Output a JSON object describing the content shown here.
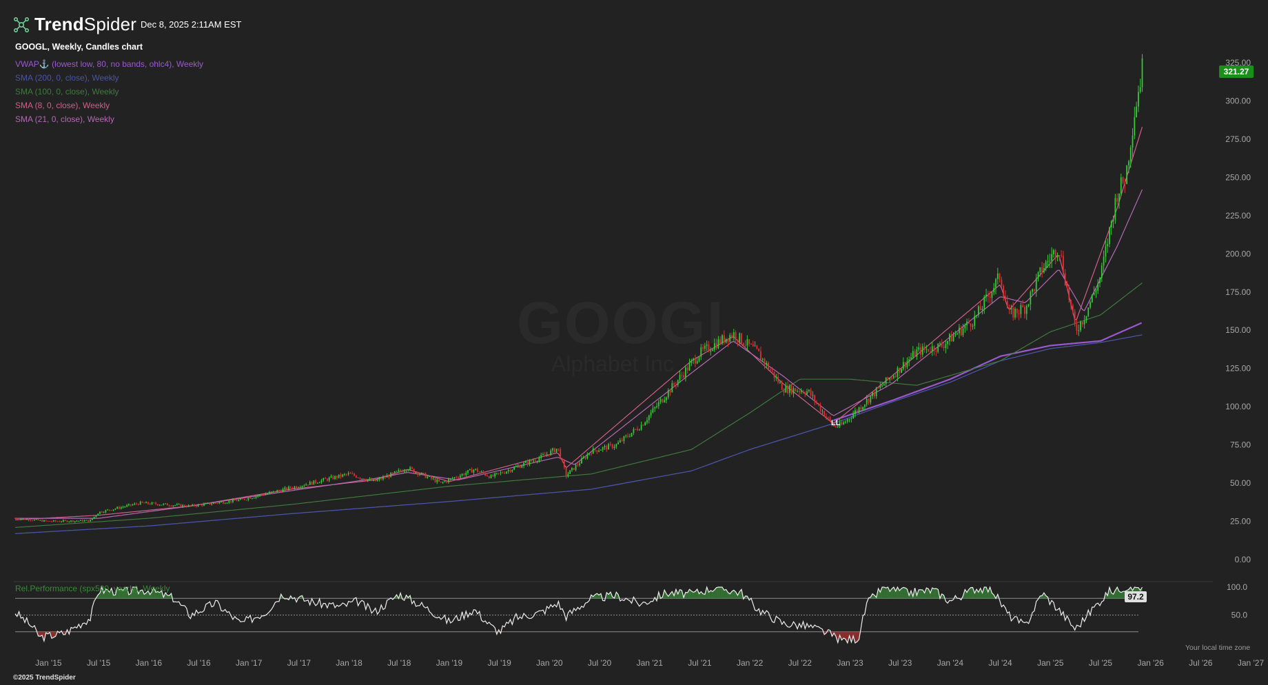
{
  "header": {
    "brand_bold": "Trend",
    "brand_rest": "Spider",
    "timestamp": "Dec 8, 2025 2:11AM EST",
    "chart_title": "GOOGL, Weekly, Candles chart"
  },
  "indicators": [
    {
      "label": "VWAP⚓ (lowest low, 80, no bands, ohlc4), Weekly",
      "color": "#9b59d0"
    },
    {
      "label": "SMA (200, 0, close), Weekly",
      "color": "#4b55a8"
    },
    {
      "label": "SMA (100, 0, close), Weekly",
      "color": "#3e7a3e"
    },
    {
      "label": "SMA (8, 0, close), Weekly",
      "color": "#d0608a"
    },
    {
      "label": "SMA (21, 0, close), Weekly",
      "color": "#b46ab4"
    }
  ],
  "watermark": {
    "symbol": "GOOGL",
    "company": "Alphabet Inc"
  },
  "price_badge": "321.27",
  "rel_perf": {
    "label": "Rel.Performance (spx500, yearly), Weekly",
    "value_badge": "97.2"
  },
  "local_time_note": "Your local time zone",
  "copyright": "©2025 TrendSpider",
  "anchor_marker": "LL",
  "colors": {
    "background": "#222222",
    "up": "#33cc33",
    "down": "#e03030",
    "badge_green": "#1a8f1a"
  },
  "chart_data": [
    {
      "type": "candlestick",
      "title": "GOOGL, Weekly, Candles chart",
      "ylim": [
        0,
        325
      ],
      "y_ticks": [
        "325.00",
        "300.00",
        "275.00",
        "250.00",
        "225.00",
        "200.00",
        "175.00",
        "150.00",
        "125.00",
        "100.00",
        "75.00",
        "50.00",
        "25.00",
        "0.00"
      ],
      "x_ticks": [
        "Jan '15",
        "Jul '15",
        "Jan '16",
        "Jul '16",
        "Jan '17",
        "Jul '17",
        "Jan '18",
        "Jul '18",
        "Jan '19",
        "Jul '19",
        "Jan '20",
        "Jul '20",
        "Jan '21",
        "Jul '21",
        "Jan '22",
        "Jul '22",
        "Jan '23",
        "Jul '23",
        "Jan '24",
        "Jul '24",
        "Jan '25",
        "Jul '25",
        "Jan '26",
        "Jul '26",
        "Jan '27"
      ],
      "x_range": [
        "2014-09",
        "2027-01"
      ],
      "close_path": [
        [
          "2014-09",
          27
        ],
        [
          "2015-01",
          25
        ],
        [
          "2015-06",
          25.5
        ],
        [
          "2015-07",
          31
        ],
        [
          "2015-12",
          37
        ],
        [
          "2016-06",
          35
        ],
        [
          "2016-12",
          39
        ],
        [
          "2017-06",
          47
        ],
        [
          "2018-01",
          56
        ],
        [
          "2018-04",
          51
        ],
        [
          "2018-08",
          60
        ],
        [
          "2018-12",
          50
        ],
        [
          "2019-04",
          59
        ],
        [
          "2019-06",
          54
        ],
        [
          "2019-12",
          67
        ],
        [
          "2020-02",
          73
        ],
        [
          "2020-03",
          55
        ],
        [
          "2020-06",
          71
        ],
        [
          "2020-09",
          75
        ],
        [
          "2020-12",
          88
        ],
        [
          "2021-04",
          115
        ],
        [
          "2021-07",
          135
        ],
        [
          "2021-11",
          148
        ],
        [
          "2022-02",
          135
        ],
        [
          "2022-05",
          112
        ],
        [
          "2022-08",
          110
        ],
        [
          "2022-11",
          87
        ],
        [
          "2022-12",
          88
        ],
        [
          "2023-03",
          104
        ],
        [
          "2023-06",
          120
        ],
        [
          "2023-09",
          136
        ],
        [
          "2023-12",
          140
        ],
        [
          "2024-04",
          158
        ],
        [
          "2024-07",
          186
        ],
        [
          "2024-08",
          160
        ],
        [
          "2024-10",
          165
        ],
        [
          "2024-12",
          190
        ],
        [
          "2025-02",
          205
        ],
        [
          "2025-04",
          150
        ],
        [
          "2025-05",
          158
        ],
        [
          "2025-07",
          185
        ],
        [
          "2025-09",
          240
        ],
        [
          "2025-10",
          250
        ],
        [
          "2025-11",
          290
        ],
        [
          "2025-12",
          321.27
        ]
      ],
      "series": [
        {
          "name": "VWAP⚓ (lowest low, 80, no bands, ohlc4), Weekly",
          "points": [
            [
              "2022-11",
              91
            ],
            [
              "2023-06",
              104
            ],
            [
              "2024-01",
              118
            ],
            [
              "2024-07",
              133
            ],
            [
              "2025-01",
              140
            ],
            [
              "2025-07",
              143
            ],
            [
              "2025-12",
              155
            ]
          ]
        },
        {
          "name": "SMA (200, 0, close), Weekly",
          "points": [
            [
              "2014-09",
              17
            ],
            [
              "2016-01",
              22
            ],
            [
              "2017-06",
              30
            ],
            [
              "2019-01",
              38
            ],
            [
              "2020-06",
              46
            ],
            [
              "2021-06",
              58
            ],
            [
              "2022-01",
              72
            ],
            [
              "2022-11",
              89
            ],
            [
              "2023-06",
              103
            ],
            [
              "2024-01",
              116
            ],
            [
              "2024-07",
              130
            ],
            [
              "2025-01",
              138
            ],
            [
              "2025-07",
              142
            ],
            [
              "2025-12",
              147
            ]
          ]
        },
        {
          "name": "SMA (100, 0, close), Weekly",
          "points": [
            [
              "2014-09",
              21
            ],
            [
              "2016-01",
              27
            ],
            [
              "2017-06",
              36
            ],
            [
              "2019-01",
              48
            ],
            [
              "2020-06",
              56
            ],
            [
              "2021-06",
              72
            ],
            [
              "2022-01",
              96
            ],
            [
              "2022-07",
              118
            ],
            [
              "2023-01",
              118
            ],
            [
              "2023-09",
              114
            ],
            [
              "2024-07",
              130
            ],
            [
              "2025-01",
              149
            ],
            [
              "2025-07",
              160
            ],
            [
              "2025-12",
              181
            ]
          ]
        },
        {
          "name": "SMA (8, 0, close), Weekly",
          "points": [
            [
              "2014-09",
              26
            ],
            [
              "2015-07",
              29
            ],
            [
              "2016-06",
              35
            ],
            [
              "2017-06",
              46
            ],
            [
              "2018-04",
              52
            ],
            [
              "2018-08",
              59
            ],
            [
              "2019-01",
              51
            ],
            [
              "2020-02",
              70
            ],
            [
              "2020-03",
              60
            ],
            [
              "2021-06",
              130
            ],
            [
              "2021-11",
              146
            ],
            [
              "2022-05",
              115
            ],
            [
              "2022-11",
              89
            ],
            [
              "2023-06",
              120
            ],
            [
              "2024-07",
              180
            ],
            [
              "2024-08",
              163
            ],
            [
              "2025-02",
              200
            ],
            [
              "2025-04",
              155
            ],
            [
              "2025-09",
              230
            ],
            [
              "2025-12",
              283
            ]
          ]
        },
        {
          "name": "SMA (21, 0, close), Weekly",
          "points": [
            [
              "2014-09",
              27
            ],
            [
              "2015-07",
              27
            ],
            [
              "2016-06",
              35
            ],
            [
              "2017-06",
              45
            ],
            [
              "2018-04",
              53
            ],
            [
              "2018-08",
              57
            ],
            [
              "2019-02",
              52
            ],
            [
              "2020-02",
              67
            ],
            [
              "2020-04",
              62
            ],
            [
              "2021-06",
              122
            ],
            [
              "2021-11",
              143
            ],
            [
              "2022-05",
              120
            ],
            [
              "2022-11",
              94
            ],
            [
              "2023-06",
              115
            ],
            [
              "2024-07",
              172
            ],
            [
              "2024-10",
              168
            ],
            [
              "2025-02",
              190
            ],
            [
              "2025-05",
              162
            ],
            [
              "2025-09",
              205
            ],
            [
              "2025-12",
              242
            ]
          ]
        }
      ]
    },
    {
      "type": "line",
      "title": "Rel.Performance (spx500, yearly), Weekly",
      "ylim": [
        0,
        100
      ],
      "y_ticks": [
        "100.0",
        "50.0"
      ],
      "levels": [
        80,
        50,
        20
      ],
      "current_value": 97.2,
      "x_range": [
        "2014-09",
        "2027-01"
      ],
      "points": [
        [
          "2014-09",
          55
        ],
        [
          "2014-11",
          30
        ],
        [
          "2014-12",
          10
        ],
        [
          "2015-03",
          18
        ],
        [
          "2015-06",
          45
        ],
        [
          "2015-07",
          95
        ],
        [
          "2015-10",
          92
        ],
        [
          "2016-01",
          95
        ],
        [
          "2016-04",
          80
        ],
        [
          "2016-06",
          50
        ],
        [
          "2016-09",
          72
        ],
        [
          "2016-12",
          35
        ],
        [
          "2017-03",
          55
        ],
        [
          "2017-05",
          88
        ],
        [
          "2017-09",
          72
        ],
        [
          "2017-12",
          65
        ],
        [
          "2018-02",
          75
        ],
        [
          "2018-04",
          55
        ],
        [
          "2018-07",
          88
        ],
        [
          "2018-10",
          65
        ],
        [
          "2019-01",
          38
        ],
        [
          "2019-04",
          60
        ],
        [
          "2019-06",
          30
        ],
        [
          "2019-07",
          20
        ],
        [
          "2019-09",
          45
        ],
        [
          "2019-12",
          55
        ],
        [
          "2020-02",
          72
        ],
        [
          "2020-03",
          48
        ],
        [
          "2020-06",
          80
        ],
        [
          "2020-09",
          85
        ],
        [
          "2020-12",
          70
        ],
        [
          "2021-03",
          90
        ],
        [
          "2021-06",
          88
        ],
        [
          "2021-09",
          100
        ],
        [
          "2021-12",
          90
        ],
        [
          "2022-02",
          60
        ],
        [
          "2022-05",
          35
        ],
        [
          "2022-08",
          30
        ],
        [
          "2022-10",
          20
        ],
        [
          "2022-12",
          5
        ],
        [
          "2023-02",
          8
        ],
        [
          "2023-03",
          70
        ],
        [
          "2023-05",
          100
        ],
        [
          "2023-08",
          90
        ],
        [
          "2023-11",
          95
        ],
        [
          "2024-01",
          75
        ],
        [
          "2024-04",
          98
        ],
        [
          "2024-06",
          96
        ],
        [
          "2024-08",
          50
        ],
        [
          "2024-10",
          30
        ],
        [
          "2024-12",
          90
        ],
        [
          "2025-02",
          60
        ],
        [
          "2025-04",
          25
        ],
        [
          "2025-06",
          60
        ],
        [
          "2025-08",
          92
        ],
        [
          "2025-10",
          100
        ],
        [
          "2025-12",
          100
        ]
      ]
    }
  ]
}
